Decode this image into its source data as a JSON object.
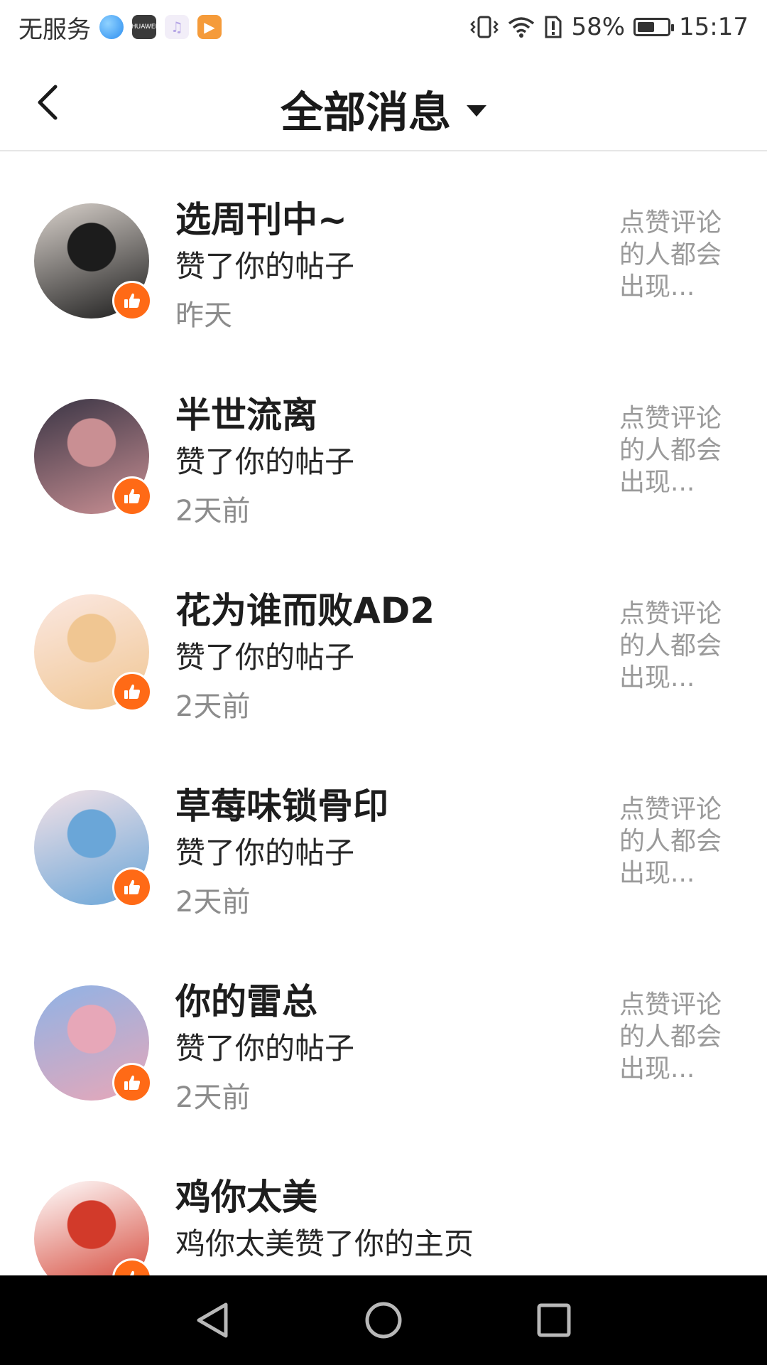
{
  "status_bar": {
    "carrier": "无服务",
    "app_icons": [
      "browser-icon",
      "huawei-icon",
      "music-icon",
      "video-icon"
    ],
    "huawei_label": "HUAWEI",
    "battery_percent": "58%",
    "battery_level": 0.58,
    "time": "15:17"
  },
  "header": {
    "title": "全部消息"
  },
  "notifications": [
    {
      "name": "选周刊中~",
      "action": "赞了你的帖子",
      "time": "昨天",
      "preview": "点赞评论的人都会出现...",
      "avatar_colors": [
        "#d9d2cc",
        "#1c1c1c"
      ]
    },
    {
      "name": "半世流离",
      "action": "赞了你的帖子",
      "time": "2天前",
      "preview": "点赞评论的人都会出现...",
      "avatar_colors": [
        "#3a3545",
        "#c98f93"
      ]
    },
    {
      "name": "花为谁而败AD2",
      "action": "赞了你的帖子",
      "time": "2天前",
      "preview": "点赞评论的人都会出现...",
      "avatar_colors": [
        "#fbe8e2",
        "#f0c692"
      ]
    },
    {
      "name": "草莓味锁骨印",
      "action": "赞了你的帖子",
      "time": "2天前",
      "preview": "点赞评论的人都会出现...",
      "avatar_colors": [
        "#f3e1e6",
        "#6aa6d8"
      ]
    },
    {
      "name": "你的雷总",
      "action": "赞了你的帖子",
      "time": "2天前",
      "preview": "点赞评论的人都会出现...",
      "avatar_colors": [
        "#8fb3e6",
        "#e7a7b8"
      ]
    },
    {
      "name": "鸡你太美",
      "action": "鸡你太美赞了你的主页",
      "time": "",
      "preview": "",
      "avatar_colors": [
        "#ffffff",
        "#d23a2a"
      ]
    }
  ],
  "colors": {
    "like_badge": "#ff6a16",
    "secondary_text": "#8c8c8c",
    "navbar": "#000000"
  }
}
